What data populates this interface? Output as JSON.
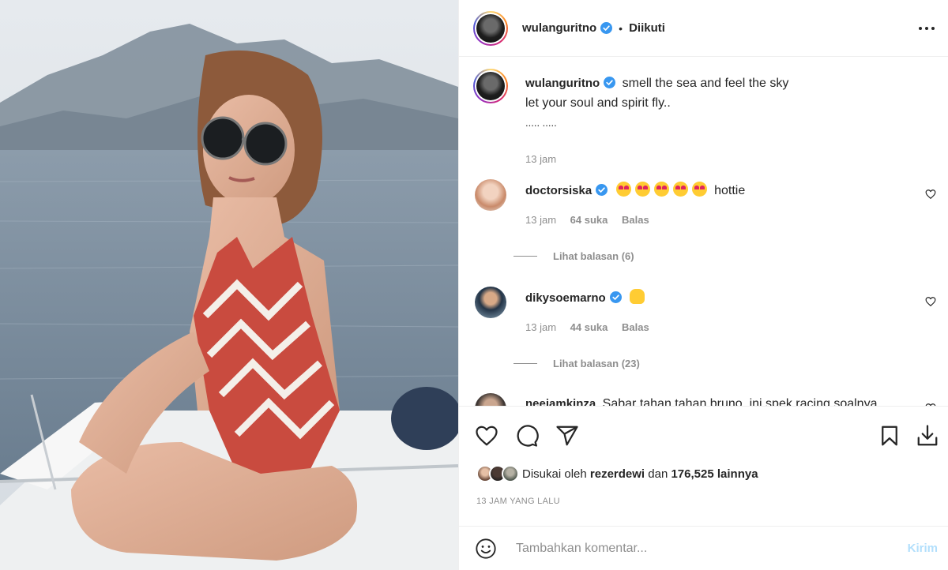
{
  "header": {
    "username": "wulanguritno",
    "separator": "•",
    "follow_state": "Diikuti"
  },
  "caption": {
    "username": "wulanguritno",
    "line1": "smell the sea and feel the sky",
    "line2": "let your soul and spirit fly..",
    "line3": "..... .....",
    "time": "13 jam"
  },
  "comments": [
    {
      "username": "doctorsiska",
      "text": "hottie",
      "emojis": [
        "heart-eyes-emoji",
        "heart-eyes-emoji",
        "heart-eyes-emoji",
        "heart-eyes-emoji",
        "heart-eyes-emoji"
      ],
      "time": "13 jam",
      "likes": "64 suka",
      "reply": "Balas",
      "view_replies": "Lihat balasan (6)"
    },
    {
      "username": "dikysoemarno",
      "text": "",
      "emojis": [
        "raised-hands-emoji"
      ],
      "time": "13 jam",
      "likes": "44 suka",
      "reply": "Balas",
      "view_replies": "Lihat balasan (23)"
    },
    {
      "username": "neejamkinza",
      "text": "Sabar tahan tahan bruno, ini spek racing soalnya"
    }
  ],
  "actions": {
    "icons": [
      "heart-icon",
      "comment-icon",
      "share-icon",
      "bookmark-icon",
      "download-icon"
    ],
    "liked_by_prefix": "Disukai oleh",
    "liked_by_user": "rezerdewi",
    "liked_by_and": "dan",
    "liked_by_count": "176,525 lainnya",
    "timestamp": "13 JAM YANG LALU"
  },
  "add_comment": {
    "placeholder": "Tambahkan komentar...",
    "post_label": "Kirim"
  },
  "colors": {
    "verified": "#3897f0",
    "muted": "#8e8e8e",
    "post_button_disabled": "#b2dffc"
  }
}
